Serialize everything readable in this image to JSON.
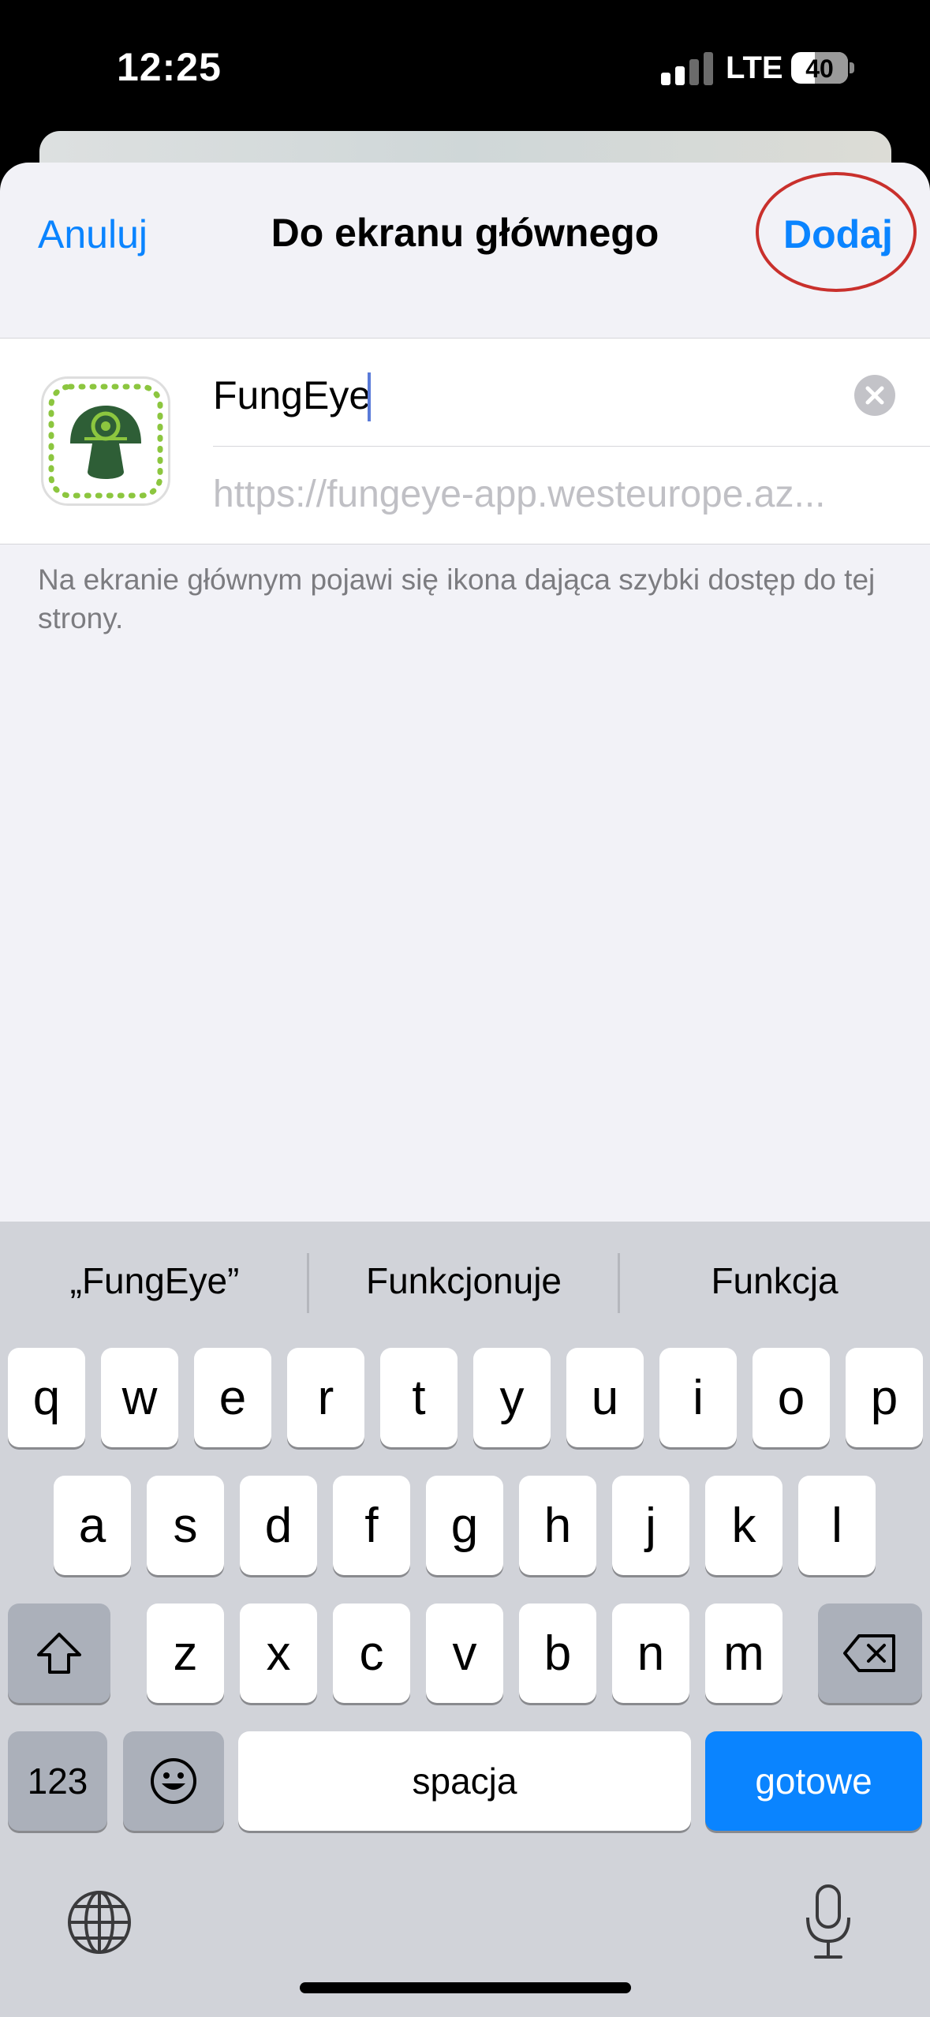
{
  "status": {
    "time": "12:25",
    "network": "LTE",
    "battery": "40",
    "battery_level": 0.4
  },
  "nav": {
    "cancel_label": "Anuluj",
    "title": "Do ekranu głównego",
    "add_label": "Dodaj"
  },
  "shortcut": {
    "name_value": "FungEye",
    "url": "https://fungeye-app.westeurope.az...",
    "icon": "mushroom-icon"
  },
  "footnote": "Na ekranie głównym pojawi się ikona dająca szybki dostęp do tej strony.",
  "keyboard": {
    "suggestions": [
      "„FungEye”",
      "Funkcjonuje",
      "Funkcja"
    ],
    "row1": [
      "q",
      "w",
      "e",
      "r",
      "t",
      "y",
      "u",
      "i",
      "o",
      "p"
    ],
    "row2": [
      "a",
      "s",
      "d",
      "f",
      "g",
      "h",
      "j",
      "k",
      "l"
    ],
    "row3": [
      "z",
      "x",
      "c",
      "v",
      "b",
      "n",
      "m"
    ],
    "numbers_label": "123",
    "space_label": "spacja",
    "return_label": "gotowe",
    "icons": {
      "shift": "shift-icon",
      "delete": "delete-icon",
      "emoji": "emoji-icon",
      "globe": "globe-icon",
      "mic": "microphone-icon"
    },
    "accent_color": "#0a84ff"
  },
  "colors": {
    "link": "#0a84ff",
    "annotation": "#c9302c",
    "icon_green": "#2e5e36",
    "icon_lime": "#8cc63f"
  }
}
